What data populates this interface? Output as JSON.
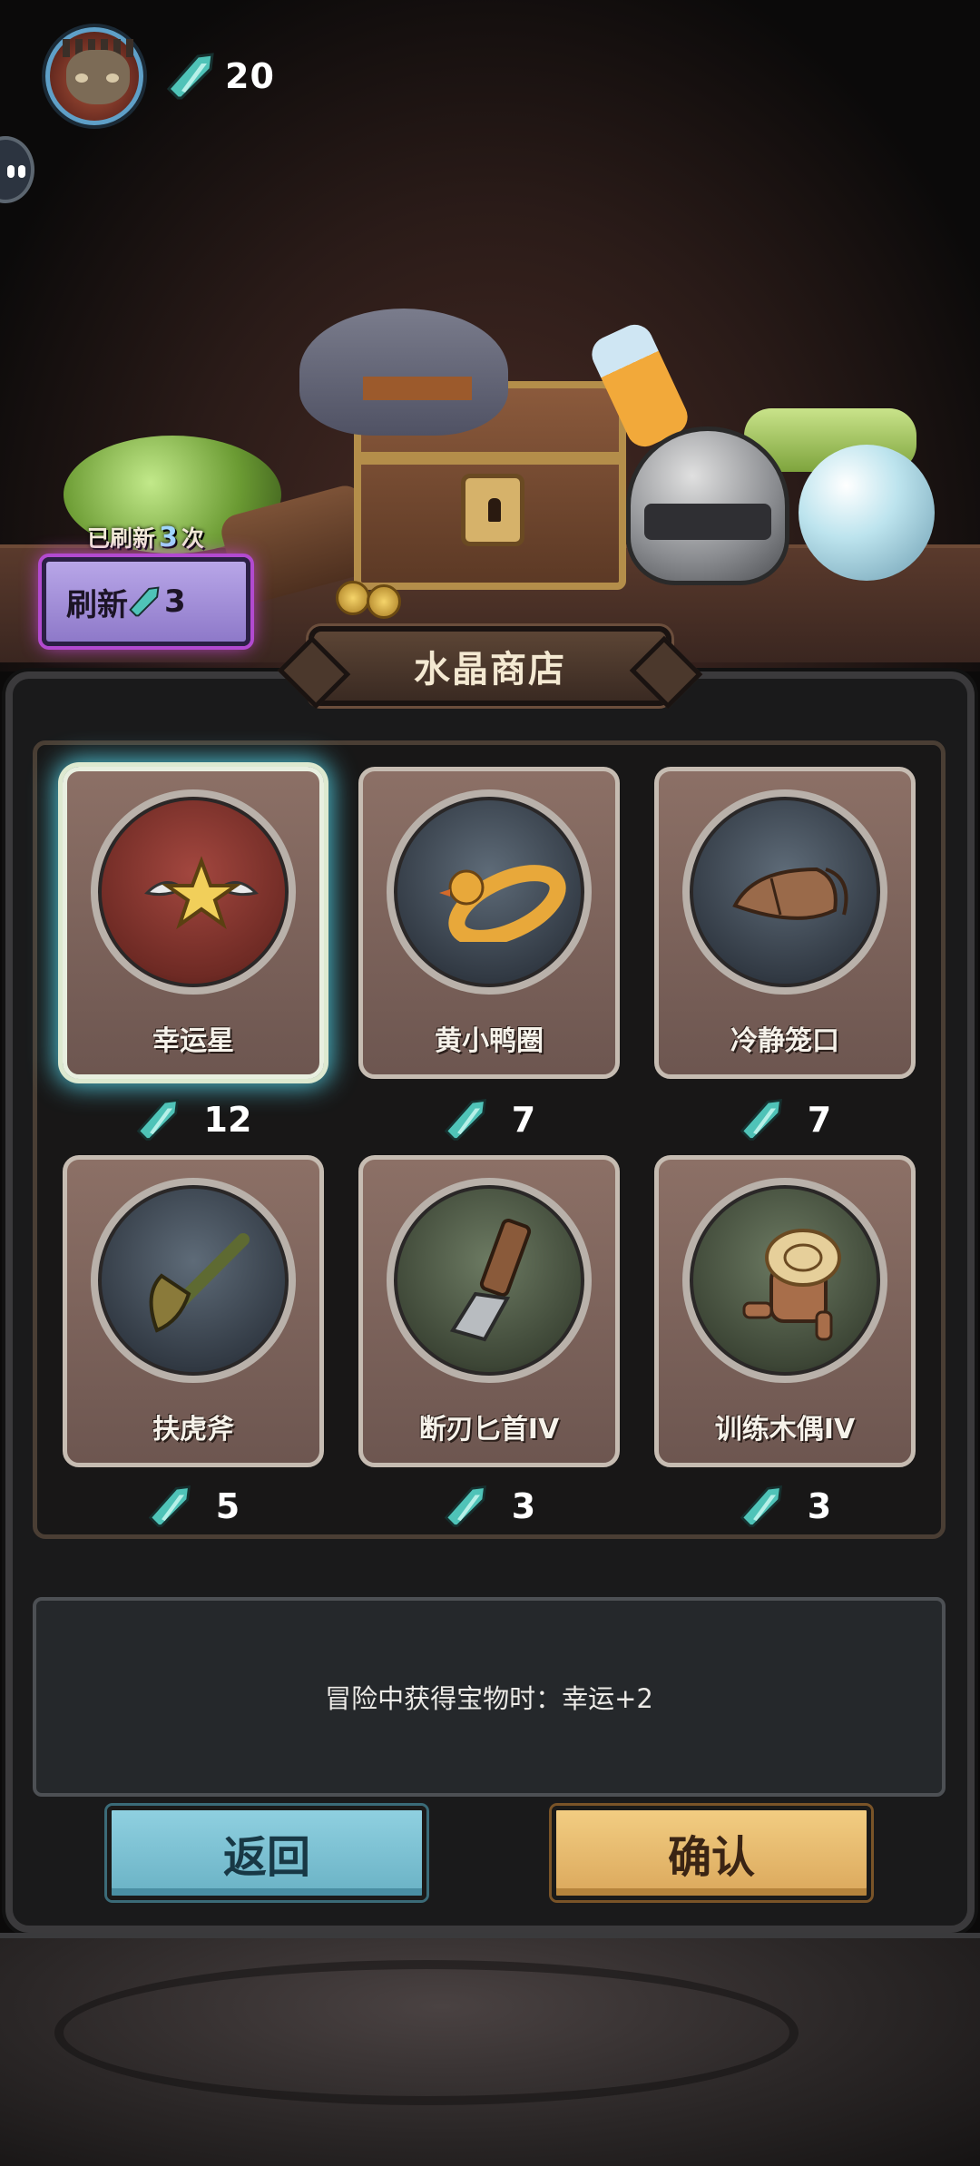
{
  "player": {
    "crystal_balance": "20"
  },
  "refresh": {
    "count_prefix": "已刷新",
    "count": "3",
    "count_suffix": "次",
    "button_label": "刷新",
    "cost": "3"
  },
  "shop": {
    "title": "水晶商店",
    "items": [
      {
        "name": "幸运星",
        "price": "12",
        "selected": true
      },
      {
        "name": "黄小鸭圈",
        "price": "7",
        "selected": false
      },
      {
        "name": "冷静笼口",
        "price": "7",
        "selected": false
      },
      {
        "name": "扶虎斧",
        "price": "5",
        "selected": false
      },
      {
        "name": "断刃匕首IV",
        "price": "3",
        "selected": false
      },
      {
        "name": "训练木偶IV",
        "price": "3",
        "selected": false
      }
    ],
    "description": "冒险中获得宝物时：幸运+2"
  },
  "actions": {
    "back_label": "返回",
    "confirm_label": "确认"
  },
  "colors": {
    "crystal": "#4fc3b8",
    "selected_glow": "#4fc3d6",
    "refresh_button": "#a996dc",
    "back_button": "#7cc2d4",
    "confirm_button": "#e8bc6e"
  }
}
